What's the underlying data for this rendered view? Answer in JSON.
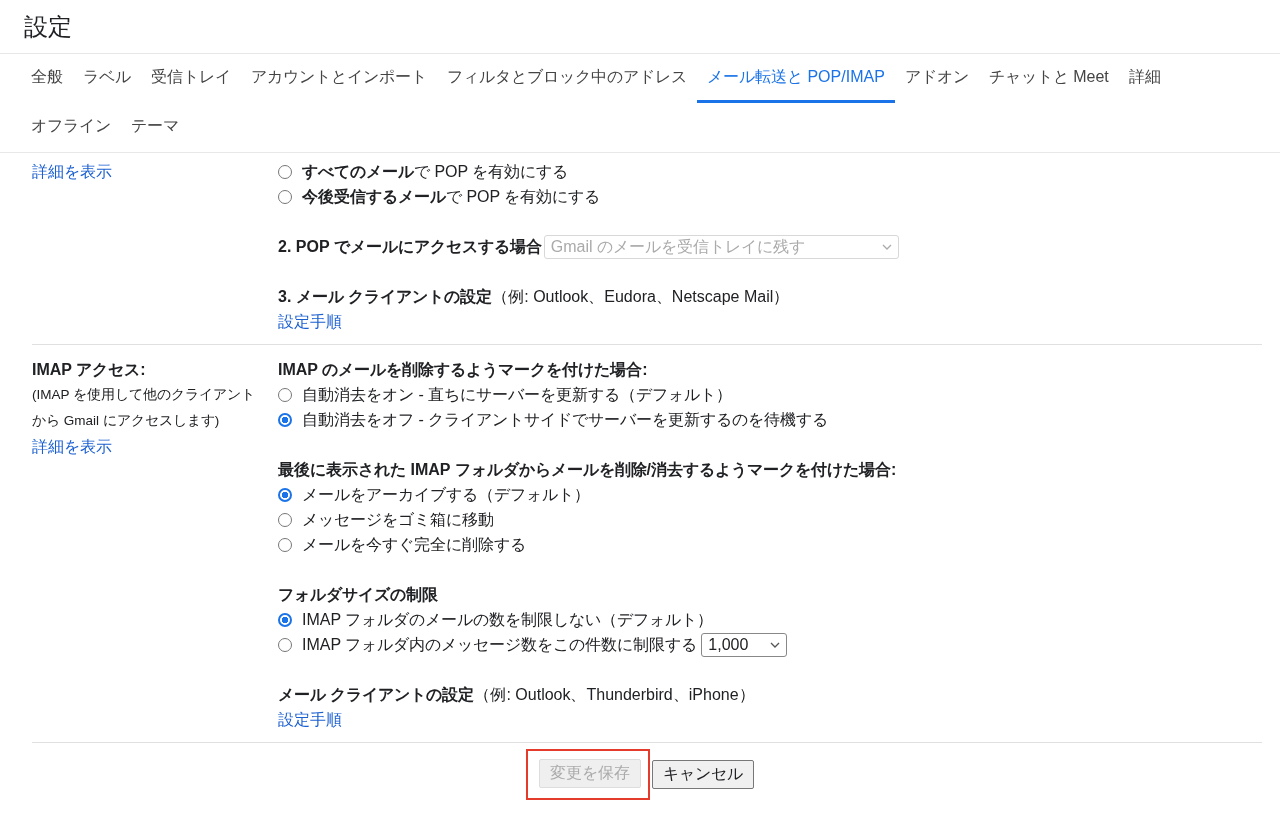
{
  "title": "設定",
  "tabs": [
    {
      "label": "全般",
      "selected": false
    },
    {
      "label": "ラベル",
      "selected": false
    },
    {
      "label": "受信トレイ",
      "selected": false
    },
    {
      "label": "アカウントとインポート",
      "selected": false
    },
    {
      "label": "フィルタとブロック中のアドレス",
      "selected": false
    },
    {
      "label": "メール転送と POP/IMAP",
      "selected": true
    },
    {
      "label": "アドオン",
      "selected": false
    },
    {
      "label": "チャットと Meet",
      "selected": false
    },
    {
      "label": "詳細",
      "selected": false
    },
    {
      "label": "オフライン",
      "selected": false
    },
    {
      "label": "テーマ",
      "selected": false
    }
  ],
  "pop": {
    "link": "詳細を表示",
    "options": [
      {
        "label": "**すべてのメール**で POP を有効にする",
        "selected": false
      },
      {
        "label": "**今後受信するメール**で POP を有効にする",
        "selected": false
      }
    ],
    "access_label": "2. POP でメールにアクセスする場合",
    "access_select": {
      "value": "Gmail のメールを受信トレイに残す",
      "disabled": true
    },
    "client_label": "**3. メール クライアントの設定**（例: Outlook、Eudora、Netscape Mail）",
    "client_link": "設定手順"
  },
  "imap": {
    "title": "IMAP アクセス:",
    "description": "(IMAP を使用して他のクライアントから Gmail にアクセスします)",
    "link": "詳細を表示",
    "groups": [
      {
        "heading": "IMAP のメールを削除するようマークを付けた場合:",
        "options": [
          {
            "label": "自動消去をオン - 直ちにサーバーを更新する（デフォルト）",
            "selected": false
          },
          {
            "label": "自動消去をオフ - クライアントサイドでサーバーを更新するのを待機する",
            "selected": true
          }
        ]
      },
      {
        "heading": "最後に表示された IMAP フォルダからメールを削除/消去するようマークを付けた場合:",
        "options": [
          {
            "label": "メールをアーカイブする（デフォルト）",
            "selected": true
          },
          {
            "label": "メッセージをゴミ箱に移動",
            "selected": false
          },
          {
            "label": "メールを今すぐ完全に削除する",
            "selected": false
          }
        ]
      },
      {
        "heading": "フォルダサイズの制限",
        "options": [
          {
            "label": "IMAP フォルダのメールの数を制限しない（デフォルト）",
            "selected": true
          },
          {
            "label": "IMAP フォルダ内のメッセージ数をこの件数に制限する",
            "selected": false,
            "select": "1,000"
          }
        ]
      }
    ],
    "client_label": "**メール クライアントの設定**（例: Outlook、Thunderbird、iPhone）",
    "client_link": "設定手順"
  },
  "buttons": [
    {
      "label": "変更を保存",
      "disabled": true,
      "highlighted": true
    },
    {
      "label": "キャンセル",
      "disabled": false,
      "highlighted": false
    }
  ]
}
